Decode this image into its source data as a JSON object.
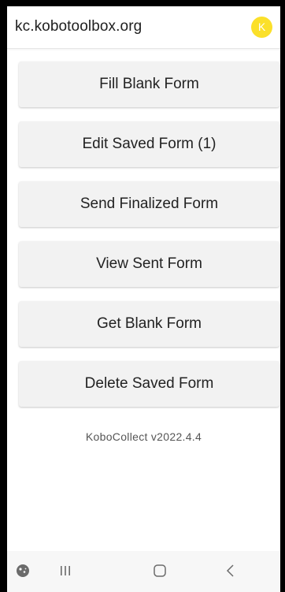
{
  "appbar": {
    "title": "kc.kobotoolbox.org",
    "avatar_letter": "K"
  },
  "menu": {
    "items": [
      {
        "label": "Fill Blank Form"
      },
      {
        "label": "Edit Saved Form (1)"
      },
      {
        "label": "Send Finalized Form"
      },
      {
        "label": "View Sent Form"
      },
      {
        "label": "Get Blank Form"
      },
      {
        "label": "Delete Saved Form"
      }
    ]
  },
  "footer": {
    "version": "KoboCollect v2022.4.4"
  },
  "navbar": {
    "icons": [
      "assistant-icon",
      "recent-apps-icon",
      "home-icon",
      "back-icon"
    ]
  },
  "colors": {
    "avatar_bg": "#fbe02a",
    "button_bg": "#f2f2f2",
    "text": "#222222"
  }
}
